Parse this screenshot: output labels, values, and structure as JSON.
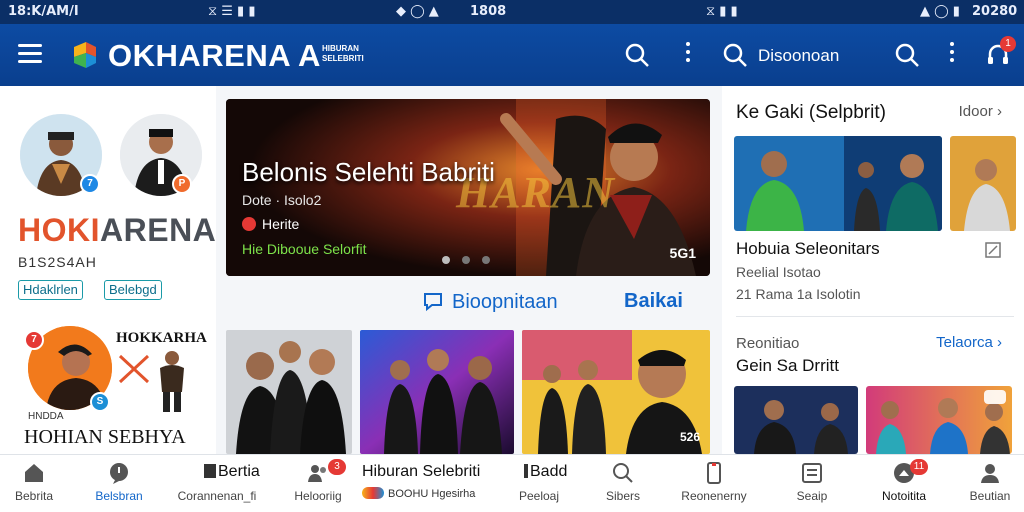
{
  "statusbar": {
    "left_time": "18:K/AM/I",
    "icons_1": "⧖ ☰ ▮ ▮",
    "time_center": "1808",
    "icons_2": "⧖ ▮ ▮",
    "time_right": "20280"
  },
  "appbar": {
    "brand": "OKHARENA",
    "brand_tail": "A",
    "brand_tag_1": "HIBURAN",
    "brand_tag_2": "SELEBRITI",
    "search_label": "Disoonoan",
    "notif_count": "1",
    "accent": "#0d4ba3"
  },
  "leftcol": {
    "brand_part_1": "HOKI",
    "brand_part_2": "ARENA",
    "code": "B1S2S4AH",
    "chip_1": "Hdaklrlen",
    "chip_2": "Belebgd",
    "promo_title": "HOKKARHA",
    "promo_small": "HNDDA",
    "promo_foot": "HOHIAN SEBHYA",
    "badge_1": "7",
    "badge_2": "P",
    "badge_3": "7",
    "badge_4": "S"
  },
  "hero": {
    "title": "Belonis Selehti Babriti",
    "meta": "Dote · Isolo2",
    "live": "Herite",
    "caption": "Hie Dibooue Selorfit",
    "count": "5G1",
    "banner_text": "HARAN"
  },
  "actions": {
    "comment": "Bioopnitaan",
    "more": "Baikai"
  },
  "tiles": {
    "caption_3": "526"
  },
  "rightpanel": {
    "title": "Ke Gaki (Selpbrit)",
    "more": "Idoor",
    "headline": "Hobuia Seleonitars",
    "sub_1": "Reelial Isotao",
    "sub_2": "21 Rama 1a Isolotin",
    "section": "Reonitiao",
    "section_link": "Telaorca",
    "section_title": "Gein Sa Drritt"
  },
  "bottomnav": {
    "items": [
      {
        "label": "Bebrita",
        "icon": "home-icon"
      },
      {
        "label": "Belsbran",
        "icon": "chat-icon"
      },
      {
        "label": "Corannenan_fi",
        "icon": "news-icon"
      },
      {
        "label": "Helooriig",
        "icon": "people-icon"
      },
      {
        "label": "BOOHU Hgesirha",
        "icon": "logo-icon"
      },
      {
        "label": "Peeloaj",
        "icon": "edit-icon"
      },
      {
        "label": "Sibers",
        "icon": "search-icon"
      },
      {
        "label": "Reonenerny",
        "icon": "phone-icon"
      },
      {
        "label": "Seaip",
        "icon": "list-icon"
      },
      {
        "label": "Notoitita",
        "icon": "bell-icon"
      },
      {
        "label": "Beutian",
        "icon": "profile-icon"
      }
    ],
    "center_title": "Hiburan Selebriti",
    "tag_1": "Bertia",
    "tag_2": "Badd",
    "badge_people": "3",
    "badge_notif": "11"
  }
}
